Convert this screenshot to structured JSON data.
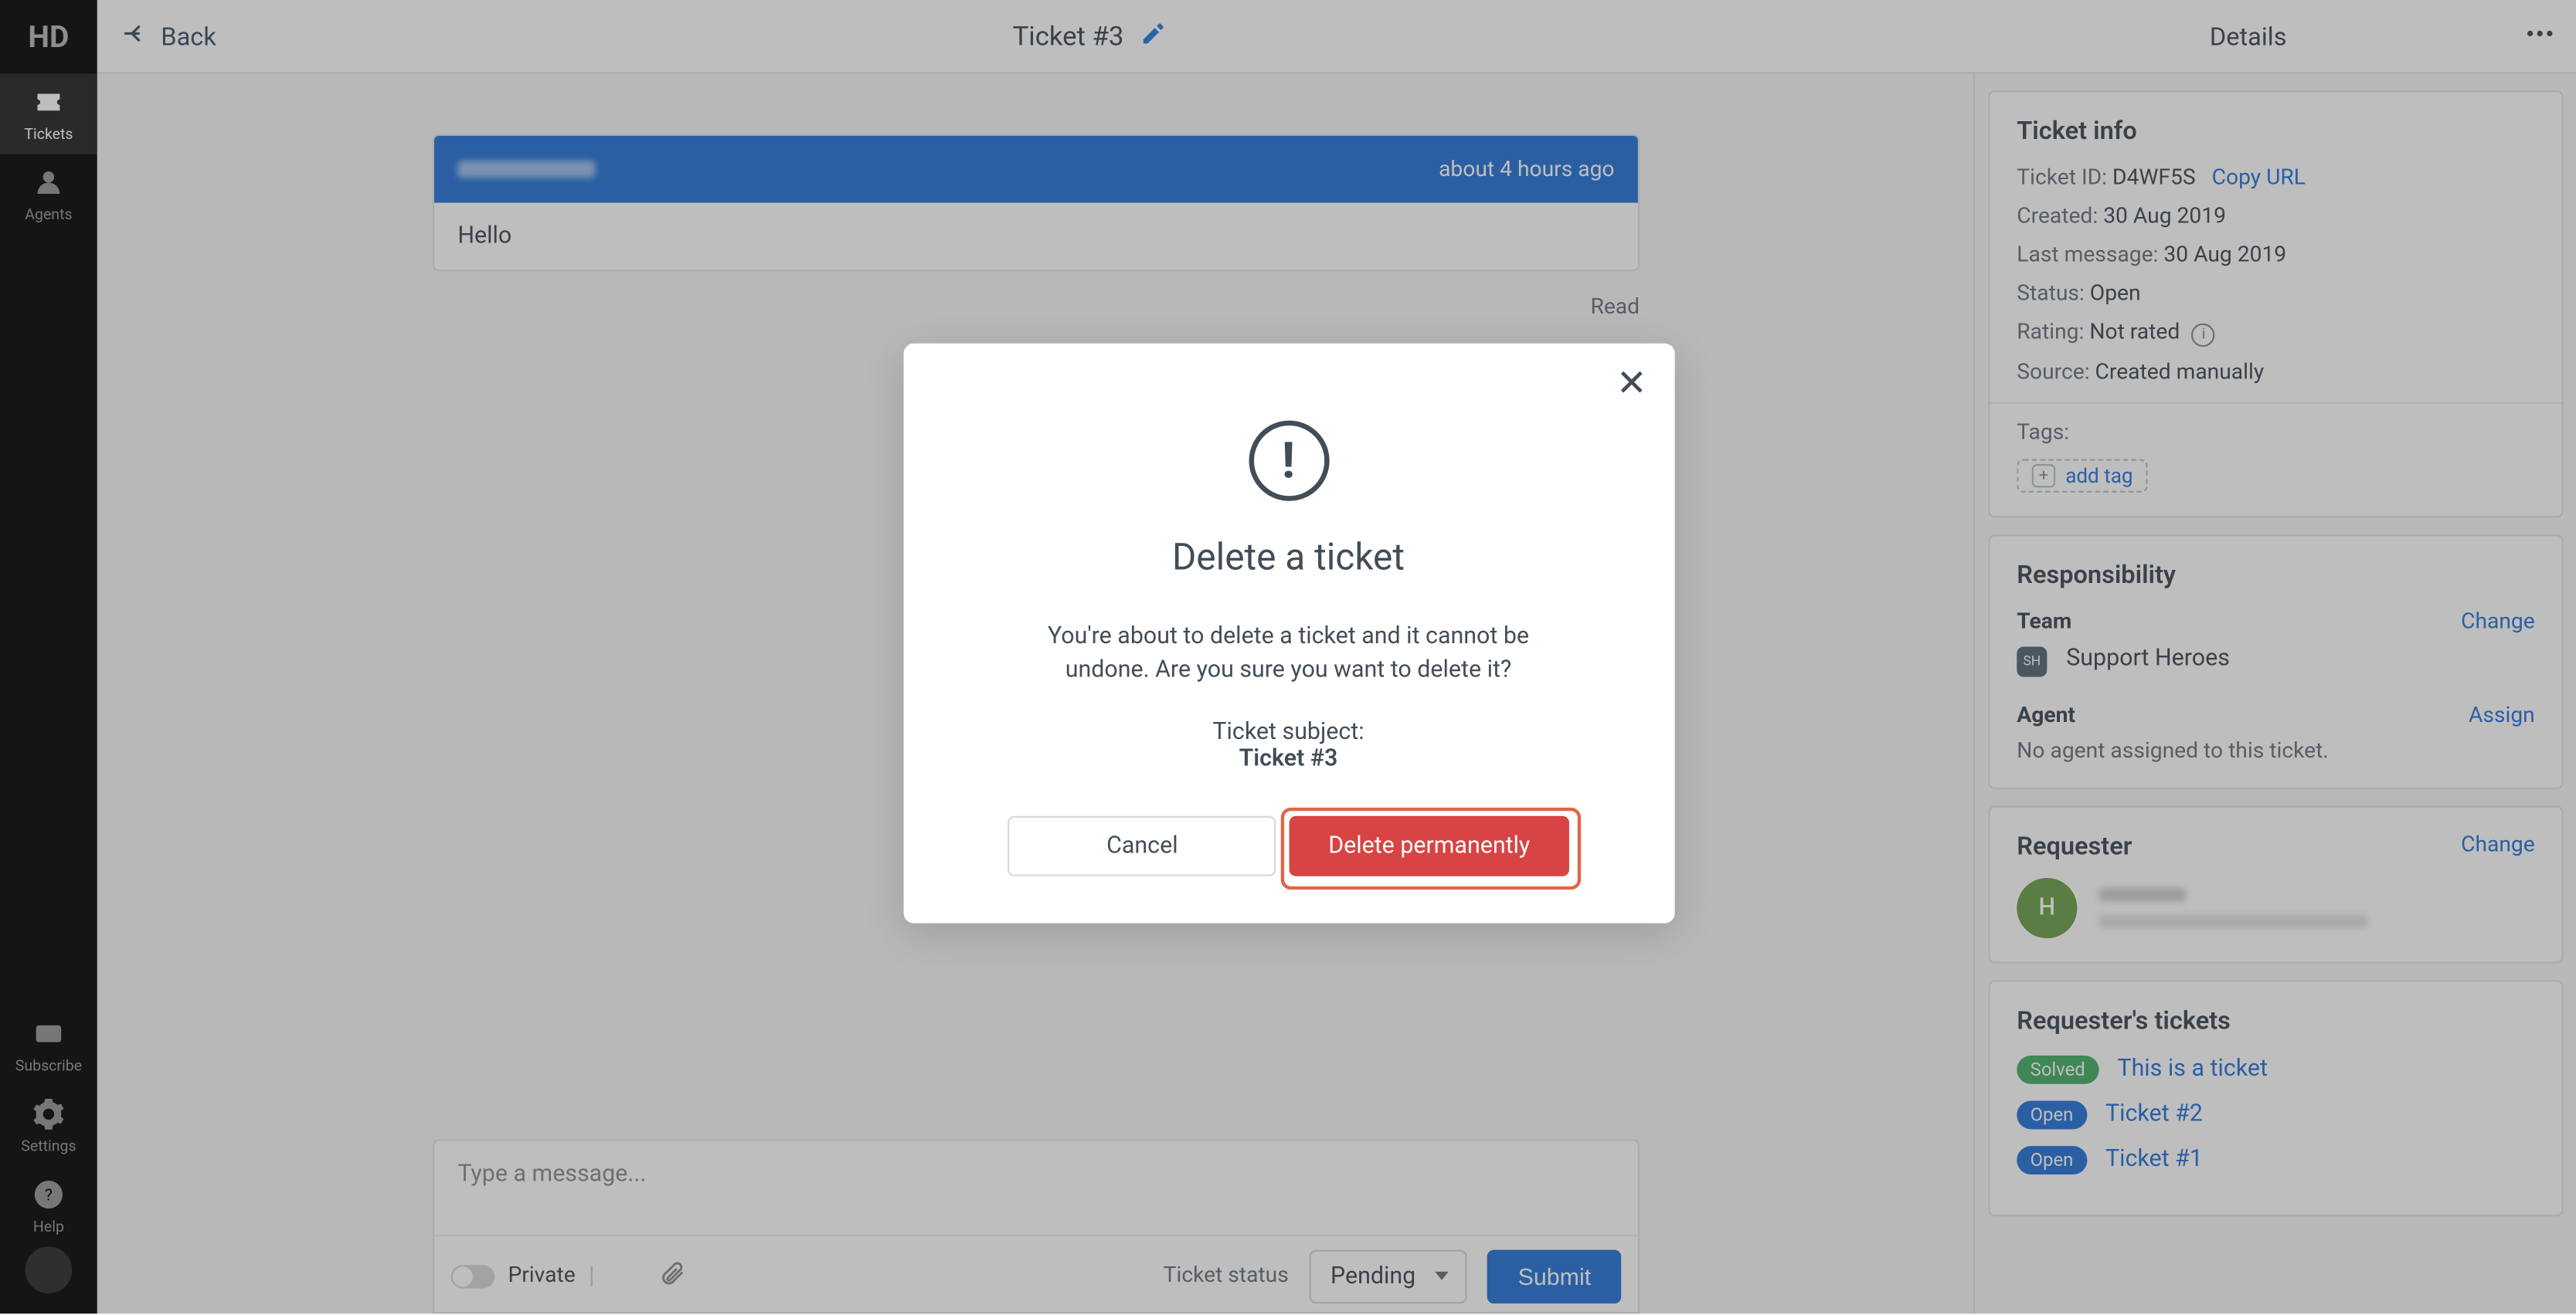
{
  "leftnav": {
    "logo": "HD",
    "items": [
      {
        "label": "Tickets"
      },
      {
        "label": "Agents"
      }
    ],
    "bottom": [
      {
        "label": "Subscribe"
      },
      {
        "label": "Settings"
      },
      {
        "label": "Help"
      }
    ]
  },
  "header": {
    "back": "Back",
    "title": "Ticket #3",
    "details_label": "Details"
  },
  "message": {
    "time": "about 4 hours ago",
    "body": "Hello",
    "read": "Read"
  },
  "composer": {
    "placeholder": "Type a message...",
    "private_label": "Private",
    "status_label": "Ticket status",
    "status_value": "Pending",
    "submit": "Submit"
  },
  "ticket_info": {
    "heading": "Ticket info",
    "id_label": "Ticket ID:",
    "id_value": "D4WF5S",
    "copy_url": "Copy URL",
    "created_label": "Created:",
    "created_value": "30 Aug 2019",
    "lastmsg_label": "Last message:",
    "lastmsg_value": "30 Aug 2019",
    "status_label": "Status:",
    "status_value": "Open",
    "rating_label": "Rating:",
    "rating_value": "Not rated",
    "source_label": "Source:",
    "source_value": "Created manually",
    "tags_label": "Tags:",
    "add_tag": "add tag"
  },
  "responsibility": {
    "heading": "Responsibility",
    "team_label": "Team",
    "team_change": "Change",
    "team_badge": "SH",
    "team_name": "Support Heroes",
    "agent_label": "Agent",
    "agent_assign": "Assign",
    "agent_none": "No agent assigned to this ticket."
  },
  "requester": {
    "heading": "Requester",
    "change": "Change",
    "initial": "H"
  },
  "requester_tickets": {
    "heading": "Requester's tickets",
    "items": [
      {
        "status": "Solved",
        "status_class": "solved",
        "title": "This is a ticket"
      },
      {
        "status": "Open",
        "status_class": "open",
        "title": "Ticket #2"
      },
      {
        "status": "Open",
        "status_class": "open",
        "title": "Ticket #1"
      }
    ]
  },
  "modal": {
    "title": "Delete a ticket",
    "desc": "You're about to delete a ticket and it cannot be undone. Are you sure you want to delete it?",
    "subj_label": "Ticket subject:",
    "subj_value": "Ticket #3",
    "cancel": "Cancel",
    "delete": "Delete permanently"
  }
}
